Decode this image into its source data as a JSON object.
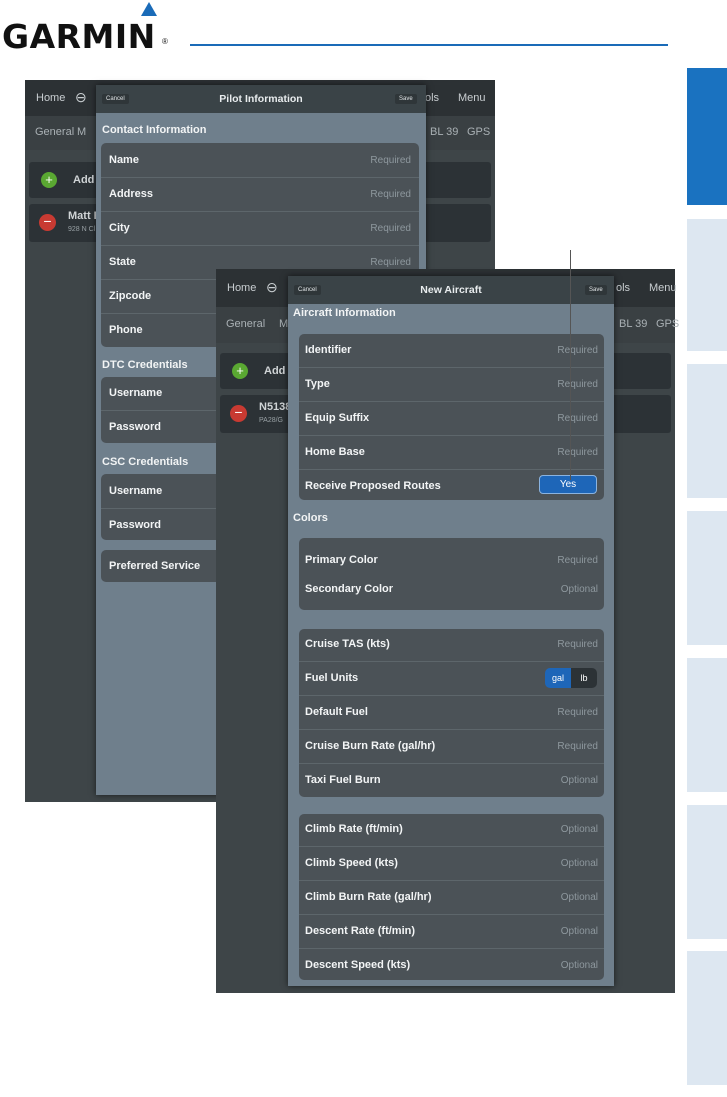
{
  "brand": {
    "logo": "GARMIN",
    "reg": "®"
  },
  "pilot_tablet": {
    "top_bar": {
      "home": "Home",
      "tools": "ols",
      "menu": "Menu"
    },
    "sub_bar": {
      "general": "General",
      "m": "M",
      "bl": "BL 39",
      "gps": "GPS"
    },
    "add_label": "Add",
    "pilot_name": "Matt B",
    "pilot_addr": "928 N Cl",
    "modal": {
      "title": "Pilot Information",
      "cancel": "Cancel",
      "save": "Save",
      "contact_header": "Contact Information",
      "contact_fields": [
        {
          "label": "Name",
          "placeholder": "Required"
        },
        {
          "label": "Address",
          "placeholder": "Required"
        },
        {
          "label": "City",
          "placeholder": "Required"
        },
        {
          "label": "State",
          "placeholder": "Required"
        },
        {
          "label": "Zipcode",
          "placeholder": ""
        },
        {
          "label": "Phone",
          "placeholder": ""
        }
      ],
      "dtc_header": "DTC Credentials",
      "dtc_fields": [
        "Username",
        "Password"
      ],
      "csc_header": "CSC Credentials",
      "csc_fields": [
        "Username",
        "Password"
      ],
      "preferred": "Preferred Service"
    }
  },
  "aircraft_tablet": {
    "top_bar": {
      "home": "Home",
      "tools": "ols",
      "menu": "Menu"
    },
    "sub_bar": {
      "general": "General",
      "m": "M",
      "bl": "BL 39",
      "gps": "GPS"
    },
    "add_label": "Add",
    "ac_id": "N5138",
    "ac_type": "PA28/G",
    "modal": {
      "title": "New Aircraft",
      "cancel": "Cancel",
      "save": "Save",
      "info_header": "Aircraft Information",
      "info_fields": [
        {
          "label": "Identifier",
          "placeholder": "Required"
        },
        {
          "label": "Type",
          "placeholder": "Required"
        },
        {
          "label": "Equip Suffix",
          "placeholder": "Required"
        },
        {
          "label": "Home Base",
          "placeholder": "Required"
        }
      ],
      "receive_label": "Receive Proposed Routes",
      "receive_value": "Yes",
      "colors_header": "Colors",
      "color_fields": [
        {
          "label": "Primary Color",
          "placeholder": "Required"
        },
        {
          "label": "Secondary Color",
          "placeholder": "Optional"
        }
      ],
      "perf_fields": [
        {
          "label": "Cruise TAS (kts)",
          "placeholder": "Required"
        },
        {
          "label": "Fuel Units",
          "placeholder": ""
        },
        {
          "label": "Default Fuel",
          "placeholder": "Required"
        },
        {
          "label": "Cruise Burn Rate (gal/hr)",
          "placeholder": "Required"
        },
        {
          "label": "Taxi Fuel Burn",
          "placeholder": "Optional"
        }
      ],
      "fuel_units": {
        "gal": "gal",
        "lb": "lb",
        "selected": "gal"
      },
      "climb_fields": [
        {
          "label": "Climb Rate (ft/min)",
          "placeholder": "Optional"
        },
        {
          "label": "Climb Speed (kts)",
          "placeholder": "Optional"
        },
        {
          "label": "Climb Burn Rate (gal/hr)",
          "placeholder": "Optional"
        },
        {
          "label": "Descent Rate (ft/min)",
          "placeholder": "Optional"
        },
        {
          "label": "Descent Speed (kts)",
          "placeholder": "Optional"
        }
      ]
    }
  },
  "colors": {
    "accent": "#1a72c0",
    "tab_inactive": "#dde7f1"
  }
}
